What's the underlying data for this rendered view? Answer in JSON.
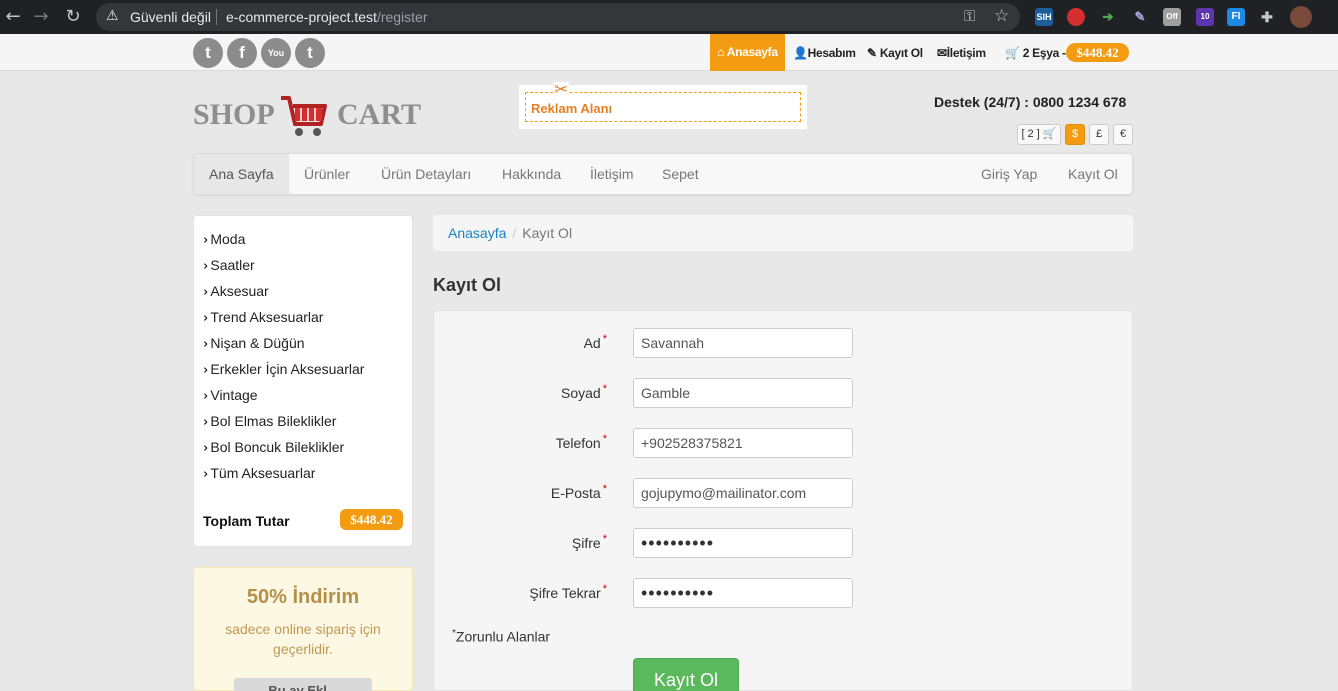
{
  "browser": {
    "back": "←",
    "forward": "→",
    "reload": "↻",
    "security_warning": "Güvenli değil",
    "url_host": "e-commerce-project.test",
    "url_path": "/register",
    "extensions": [
      {
        "icon": "sih-extension-icon",
        "text": "SIH",
        "color": "#1b5e9c"
      },
      {
        "icon": "shield-extension-icon",
        "text": "",
        "color": "#d32f2f"
      },
      {
        "icon": "arrow-extension-icon",
        "text": "➔",
        "color": "#2e7d32"
      },
      {
        "icon": "pen-extension-icon",
        "text": "✎",
        "color": "#3949ab"
      },
      {
        "icon": "off-extension-icon",
        "text": "Off",
        "color": "#9e9e9e"
      },
      {
        "icon": "badge-extension-icon",
        "text": "10",
        "color": "#5e35b1"
      },
      {
        "icon": "fi-extension-icon",
        "text": "FI",
        "color": "#1e88e5"
      },
      {
        "icon": "puzzle-extension-icon",
        "text": "✚",
        "color": "#5f6368"
      }
    ]
  },
  "topbar": {
    "social": [
      "twitter",
      "facebook",
      "youtube",
      "tumblr"
    ],
    "social_glyphs": [
      "t",
      "f",
      "You",
      "t"
    ],
    "links": {
      "home": "Anasayfa",
      "account": "Hesabım",
      "register": "Kayıt Ol",
      "contact": "İletişim",
      "cart": "2 Eşya -",
      "cart_total": "$448.42"
    }
  },
  "header": {
    "logo_left": "SHOP",
    "logo_right": "CART",
    "ad_label": "Reklam Alanı",
    "support": "Destek (24/7) : 0800 1234 678",
    "mini_cart": "[ 2 ]",
    "currencies": [
      "$",
      "£",
      "€"
    ]
  },
  "nav": {
    "left": [
      "Ana Sayfa",
      "Ürünler",
      "Ürün Detayları",
      "Hakkında",
      "İletişim",
      "Sepet"
    ],
    "right": [
      "Giriş Yap",
      "Kayıt Ol"
    ]
  },
  "sidebar": {
    "categories": [
      "Moda",
      "Saatler",
      "Aksesuar",
      "Trend Aksesuarlar",
      "Nişan & Düğün",
      "Erkekler İçin Aksesuarlar",
      "Vintage",
      "Bol Elmas Bileklikler",
      "Bol Boncuk Bileklikler",
      "Tüm Aksesuarlar"
    ],
    "total_label": "Toplam Tutar",
    "total_value": "$448.42"
  },
  "promo": {
    "title": "50% İndirim",
    "text": "sadece online sipariş için geçerlidir.",
    "button": "Bu ay Ekl..."
  },
  "breadcrumb": {
    "home": "Anasayfa",
    "current": "Kayıt Ol"
  },
  "form": {
    "title": "Kayıt Ol",
    "fields": [
      {
        "label": "Ad",
        "value": "Savannah",
        "type": "text"
      },
      {
        "label": "Soyad",
        "value": "Gamble",
        "type": "text"
      },
      {
        "label": "Telefon",
        "value": "+902528375821",
        "type": "text"
      },
      {
        "label": "E-Posta",
        "value": "gojupymo@mailinator.com",
        "type": "text"
      },
      {
        "label": "Şifre",
        "value": "••••••••••",
        "type": "password"
      },
      {
        "label": "Şifre Tekrar",
        "value": "••••••••••",
        "type": "password"
      }
    ],
    "required_star": "*",
    "required_note": "Zorunlu Alanlar",
    "submit": "Kayıt Ol"
  },
  "colors": {
    "accent": "#f39c12",
    "success": "#5cb85c",
    "link": "#1a84c7"
  }
}
